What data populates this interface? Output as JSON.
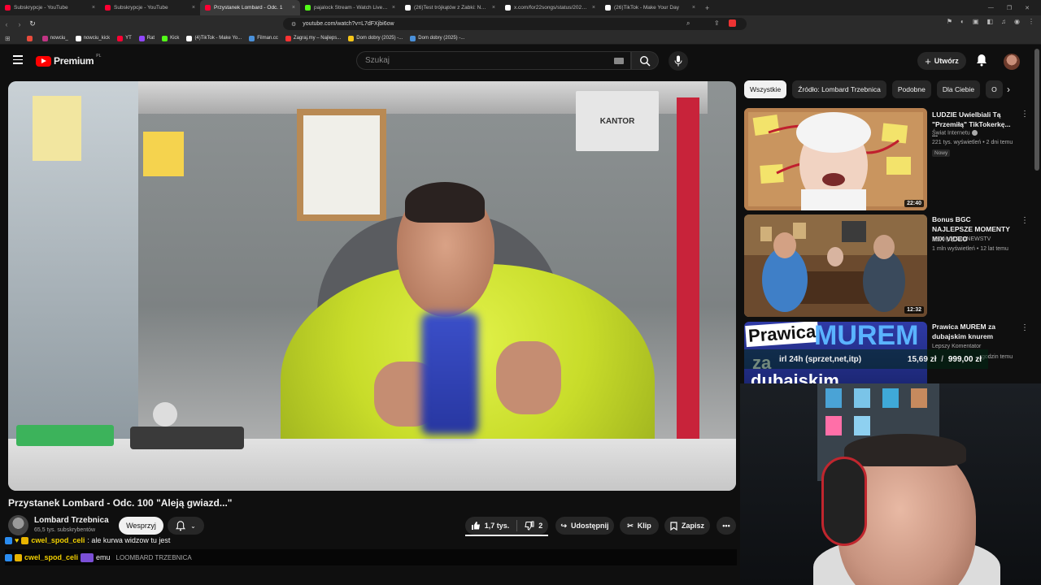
{
  "browser": {
    "tabs": [
      {
        "label": "Subskrypcje - YouTube",
        "color": "#ff0033",
        "active": false
      },
      {
        "label": "Subskrypcje - YouTube",
        "color": "#ff0033",
        "active": false
      },
      {
        "label": "Przystanek Lombard - Odc. 1",
        "color": "#ff0033",
        "active": true
      },
      {
        "label": "pajalock Stream - Watch Live on Kick",
        "color": "#53fc18",
        "active": false
      },
      {
        "label": "(26)Test trójkątów z Żabki: Najlepsz",
        "color": "#ffffff",
        "active": false
      },
      {
        "label": "x.com/for22songs/status/202859019",
        "color": "#ffffff",
        "active": false
      },
      {
        "label": "(26)TikTok - Make Your Day",
        "color": "#ffffff",
        "active": false
      }
    ],
    "url": "youtube.com/watch?v=L7dFXjbi6ow",
    "bookmarks": [
      {
        "label": "",
        "color": "#e84b3c"
      },
      {
        "label": "nowciu_",
        "color": "#c13584"
      },
      {
        "label": "nowciu_kick",
        "color": "#ffffff"
      },
      {
        "label": "YT",
        "color": "#ff0033"
      },
      {
        "label": "Rat",
        "color": "#9146ff"
      },
      {
        "label": "Kick",
        "color": "#53fc18"
      },
      {
        "label": "(4)TikTok - Make Yo...",
        "color": "#ffffff"
      },
      {
        "label": "Filman.cc",
        "color": "#4a90d9"
      },
      {
        "label": "Zagraj.my – Najleps...",
        "color": "#ff3333"
      },
      {
        "label": "Dom dobry (2025) -...",
        "color": "#f5c518"
      },
      {
        "label": "Dom dobry (2025) -...",
        "color": "#4a90d9"
      }
    ]
  },
  "youtube": {
    "logo_text": "Premium",
    "logo_region": "PL",
    "search_placeholder": "Szukaj",
    "create_label": "Utwórz"
  },
  "video": {
    "title": "Przystanek Lombard - Odc. 100 \"Aleją gwiazd...\"",
    "kantor_sign": "KANTOR",
    "channel": "Lombard Trzebnica",
    "subscribers": "65,5 tys. subskrybentów",
    "support_label": "Wesprzyj",
    "likes": "1,7 tys.",
    "dislikes": "2",
    "share_label": "Udostępnij",
    "clip_label": "Klip",
    "save_label": "Zapisz"
  },
  "chat": [
    {
      "user": "cwel_spod_celi",
      "text": ": ale kurwa widzow tu jest",
      "role": ""
    },
    {
      "user": "cwel_spod_celi",
      "text": "emu",
      "role": "LOOMBARD TRZEBNICA"
    }
  ],
  "chips": [
    "Wszystkie",
    "Źródło: Lombard Trzebnica",
    "Podobne",
    "Dla Ciebie",
    "O"
  ],
  "recommendations": [
    {
      "title": "LUDZIE Uwielbiali Tą \"Przemiłą\" TikTokerkę... ...",
      "channel": "Świat Internetu",
      "verified": true,
      "meta": "221 tys. wyświetleń • 2 dni temu",
      "badge": "Nowy",
      "duration": "22:40"
    },
    {
      "title": "Bonus BGC NAJLEPSZE MOMENTY MIX VIDEO",
      "channel": "HHNigdyStopNEWSTV",
      "verified": false,
      "meta": "1 mln wyświetleń • 12 lat temu",
      "badge": "",
      "duration": "12:32"
    },
    {
      "title": "Prawica MUREM za dubajskim knurem",
      "channel": "Lepszy Komentator",
      "verified": false,
      "meta": "godzin temu",
      "badge": "",
      "duration": ""
    }
  ],
  "thumb3_text": {
    "line1": "Prawica",
    "line2": "MUREM",
    "line3": "za",
    "line4": "dubajskim"
  },
  "stream_overlay": {
    "label": "irl 24h (sprzet,net,itp)",
    "current": "15,69 zł",
    "goal": "999,00 zł"
  }
}
